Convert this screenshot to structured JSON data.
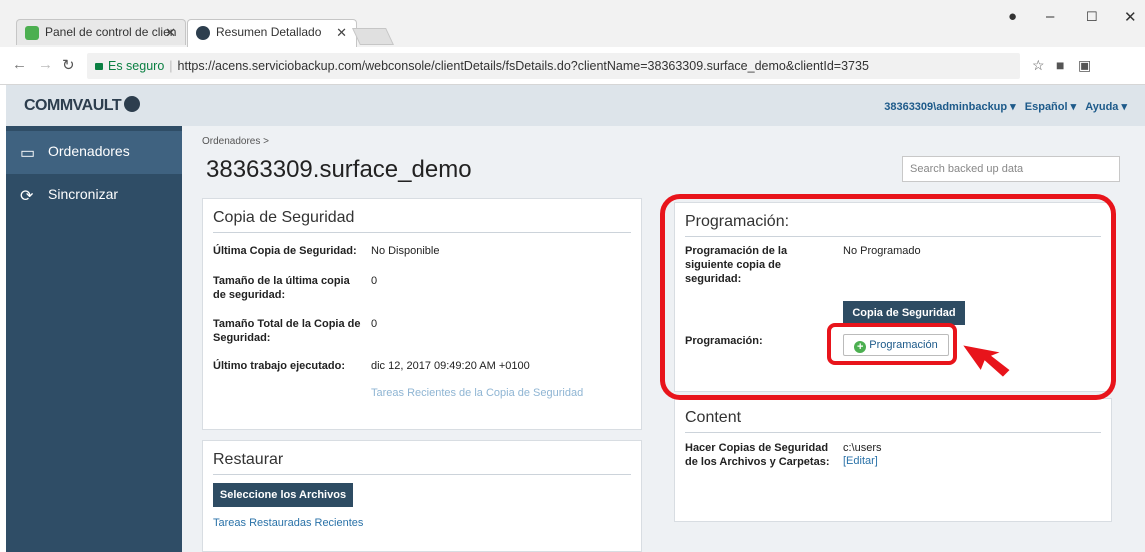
{
  "browser": {
    "tabs": [
      {
        "label": "Panel de control de clien",
        "favicon_color": "#4caf50"
      },
      {
        "label": "Resumen Detallado",
        "favicon_color": "#2d3e4e"
      }
    ],
    "secure_label": "Es seguro",
    "url": "https://acens.serviciobackup.com/webconsole/clientDetails/fsDetails.do?clientName=38363309.surface_demo&clientId=3735"
  },
  "header": {
    "logo": "COMMVAULT",
    "user": "38363309\\adminbackup ▾",
    "language": "Español ▾",
    "help": "Ayuda ▾"
  },
  "sidebar": {
    "items": [
      {
        "label": "Ordenadores",
        "icon": "laptop-icon"
      },
      {
        "label": "Sincronizar",
        "icon": "sync-icon"
      }
    ]
  },
  "main": {
    "breadcrumb": "Ordenadores  >",
    "title": "38363309.surface_demo",
    "search_placeholder": "Search backed up data"
  },
  "backup": {
    "title": "Copia de Seguridad",
    "last_backup_label": "Última Copia de Seguridad:",
    "last_backup_value": "No Disponible",
    "last_size_label": "Tamaño de la última copia de seguridad:",
    "last_size_value": "0",
    "total_size_label": "Tamaño Total de la Copia de Seguridad:",
    "total_size_value": "0",
    "last_job_label": "Último trabajo ejecutado:",
    "last_job_value": "dic 12, 2017 09:49:20 AM +0100",
    "recent_link": "Tareas Recientes de la Copia de Seguridad"
  },
  "restore": {
    "title": "Restaurar",
    "select_button": "Seleccione los Archivos",
    "recent_link": "Tareas Restauradas Recientes"
  },
  "schedule": {
    "title": "Programación:",
    "next_label": "Programación de la siguiente copia de seguridad:",
    "next_value": "No Programado",
    "backup_button": "Copia de Seguridad",
    "schedule_label": "Programación:",
    "schedule_button": "Programación"
  },
  "content": {
    "title": "Content",
    "label": "Hacer Copias de Seguridad de los Archivos y Carpetas:",
    "path": "c:\\users",
    "edit_link": "[Editar]"
  },
  "annotation_color": "#e8141b"
}
